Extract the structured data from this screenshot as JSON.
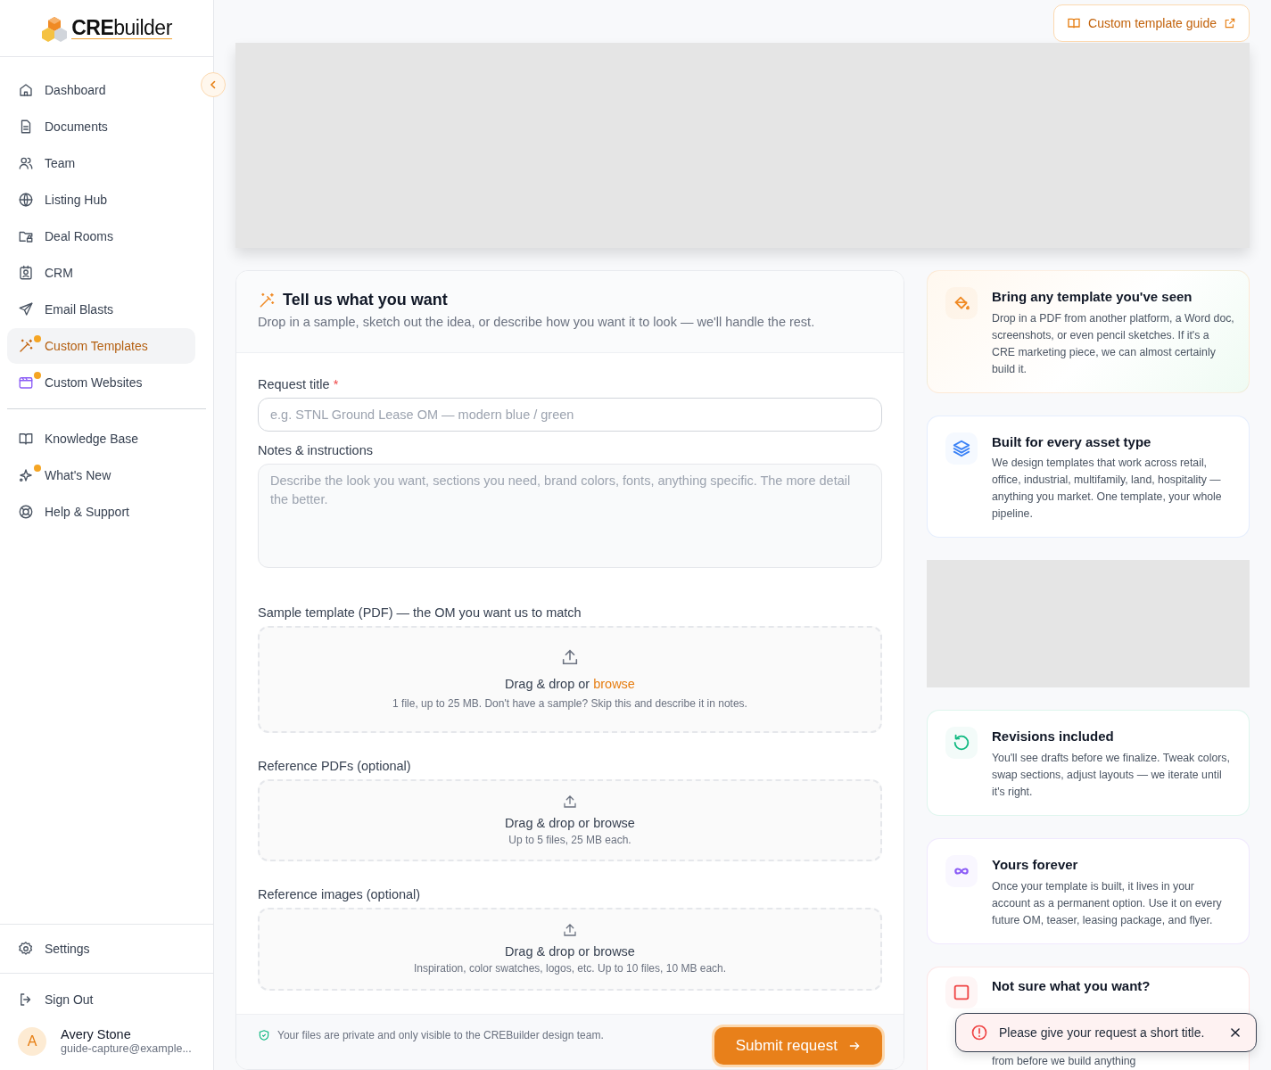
{
  "logo": {
    "bold": "CRE",
    "light": "builder"
  },
  "nav": [
    {
      "label": "Dashboard",
      "selected": false,
      "dot": false
    },
    {
      "label": "Documents",
      "selected": false,
      "dot": false
    },
    {
      "label": "Team",
      "selected": false,
      "dot": false
    },
    {
      "label": "Listing Hub",
      "selected": false,
      "dot": false
    },
    {
      "label": "Deal Rooms",
      "selected": false,
      "dot": false
    },
    {
      "label": "CRM",
      "selected": false,
      "dot": false
    },
    {
      "label": "Email Blasts",
      "selected": false,
      "dot": false
    },
    {
      "label": "Custom Templates",
      "selected": true,
      "dot": true
    },
    {
      "label": "Custom Websites",
      "selected": false,
      "dot": true
    }
  ],
  "nav_secondary": [
    {
      "label": "Knowledge Base",
      "selected": false,
      "dot": false
    },
    {
      "label": "What's New",
      "selected": false,
      "dot": true
    },
    {
      "label": "Help & Support",
      "selected": false,
      "dot": false
    }
  ],
  "settings": {
    "label": "Settings"
  },
  "sign_out": {
    "label": "Sign Out"
  },
  "user": {
    "initial": "A",
    "name": "Avery Stone",
    "email": "guide-capture@example..."
  },
  "guide_button": {
    "label": "Custom template guide"
  },
  "form": {
    "title": "Tell us what you want",
    "subtitle": "Drop in a sample, sketch out the idea, or describe how you want it to look — we'll handle the rest.",
    "title_field": {
      "label": "Request title",
      "required_mark": "*",
      "placeholder": "e.g. STNL Ground Lease OM — modern blue / green"
    },
    "notes_field": {
      "label": "Notes & instructions",
      "placeholder": "Describe the look you want, sections you need, brand colors, fonts, anything specific. The more detail the better."
    },
    "dropzones": [
      {
        "label": "Sample template (PDF) — the OM you want us to match",
        "primary": true,
        "prompt": "Drag & drop or",
        "link": "browse",
        "hint": "1 file, up to 25 MB. Don't have a sample? Skip this and describe it in notes."
      },
      {
        "label": "Reference PDFs (optional)",
        "primary": false,
        "prompt": "Drag & drop or browse",
        "hint": "Up to 5 files, 25 MB each."
      },
      {
        "label": "Reference images (optional)",
        "primary": false,
        "prompt": "Drag & drop or browse",
        "hint": "Inspiration, color swatches, logos, etc. Up to 10 files, 10 MB each."
      }
    ],
    "privacy_note": "Your files are private and only visible to the CREBuilder design team.",
    "submit": {
      "label": "Submit request"
    }
  },
  "side_cards": [
    {
      "kind": "feature",
      "title": "Bring any template you've seen",
      "body": "Drop in a PDF from another platform, a Word doc, screenshots, or even pencil sketches. If it's a CRE marketing piece, we can almost certainly build it.",
      "color": "#f08a24"
    },
    {
      "kind": "feature",
      "title": "Built for every asset type",
      "body": "We design templates that work across retail, office, industrial, multifamily, land, hospitality — anything you market. One template, your whole pipeline.",
      "color": "#3b82f6"
    },
    {
      "kind": "placeholder"
    },
    {
      "kind": "feature",
      "title": "Revisions included",
      "body": "You'll see drafts before we finalize. Tweak colors, swap sections, adjust layouts — we iterate until it's right.",
      "color": "#10b981"
    },
    {
      "kind": "feature",
      "title": "Yours forever",
      "body": "Once your template is built, it lives in your account as a permanent option. Use it on every future OM, teaser, leasing package, and flyer.",
      "color": "#8b5cf6"
    },
    {
      "kind": "feature",
      "title": "Not sure what you want?",
      "body": "from before we build anything",
      "color": "#ef4444"
    }
  ],
  "toast": {
    "message": "Please give your request a short title."
  }
}
